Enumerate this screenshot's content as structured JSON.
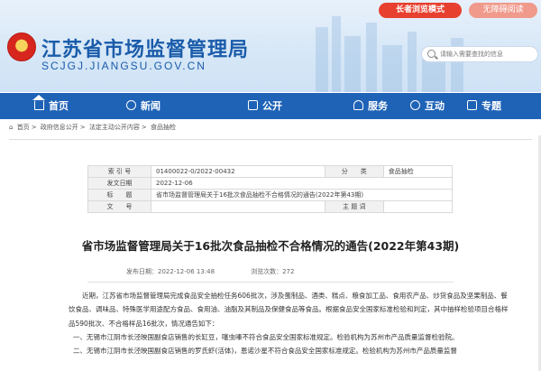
{
  "header": {
    "mode_buttons": [
      "长者浏览模式",
      "无障碍阅读"
    ],
    "site_title": "江苏省市场监督管理局",
    "site_domain": "SCJGJ.JIANGSU.GOV.CN",
    "emblem_text": "★",
    "search_placeholder": "请输入需要查找的信息",
    "colors": {
      "primary": "#1f63b7",
      "elder_button": "#e8402f",
      "access_button": "#f09a8c"
    }
  },
  "nav": {
    "items": [
      {
        "label": "首页",
        "icon": "home-icon"
      },
      {
        "label": "新闻",
        "icon": "news-icon"
      },
      {
        "label": "公开",
        "icon": "open-icon"
      },
      {
        "label": "服务",
        "icon": "service-icon"
      },
      {
        "label": "互动",
        "icon": "interact-icon"
      },
      {
        "label": "专题",
        "icon": "topic-icon"
      }
    ]
  },
  "breadcrumb": [
    "首页",
    "政府信息公开",
    "法定主动公开内容",
    "食品抽检"
  ],
  "meta": {
    "index_label": "索 引 号",
    "index_value": "01400022-0/2022-00432",
    "category_label": "分　　类",
    "category_value": "食品抽检",
    "date_label": "发文日期",
    "date_value": "2022-12-06",
    "title_label": "标　　题",
    "title_value": "省市场监督管理局关于16批次食品抽检不合格情况的通告(2022年第43期)",
    "docno_label": "文　　号",
    "docno_value": "",
    "subject_label": "主 题 词",
    "subject_value": ""
  },
  "article": {
    "title": "省市场监督管理局关于16批次食品抽检不合格情况的通告(2022年第43期)",
    "publish_time": "发布日期：2022-12-06 13:48",
    "views": "浏览次数：272",
    "paragraphs": [
      "近期，江苏省市场监督管理局完成食品安全抽检任务606批次，涉及蛋制品、酒类、糕点、粮食加工品、食用农产品、炒货食品及坚果制品、餐饮食品、调味品、特殊医学用途配方食品、食用油、油脂及其制品及保健食品等食品。根据食品安全国家标准检验和判定，其中抽样检验项目合格样品590批次、不合格样品16批次，情况通告如下：",
      "一、无锡市江阴市长泾映国副食店销售的长缸豆，噻虫嗪不符合食品安全国家标准规定。检验机构为苏州市产品质量监督检验院。",
      "二、无锡市江阴市长泾映国副食店销售的罗氏虾(活体)，恩诺沙星不符合食品安全国家标准规定。检验机构为苏州市产品质量监督"
    ]
  }
}
